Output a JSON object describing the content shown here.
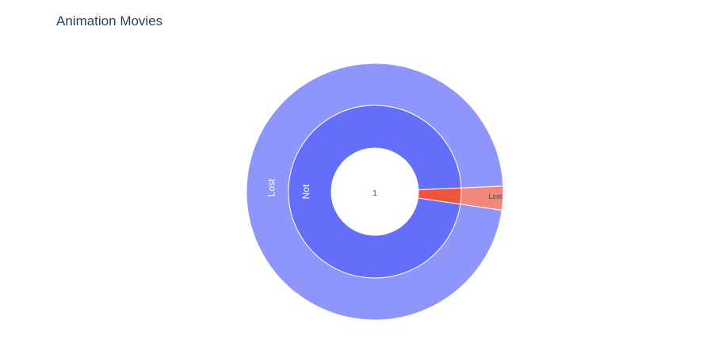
{
  "chart_data": {
    "type": "sunburst",
    "title": "Animation Movies",
    "center_label": "1",
    "inner_ring": [
      {
        "label": "Not",
        "value": 0.97,
        "color": "#636efa"
      },
      {
        "label": "",
        "value": 0.03,
        "color": "#ef553b"
      }
    ],
    "outer_ring": [
      {
        "label": "Lost",
        "value": 0.97,
        "color": "#8f96fb",
        "parent": "Not"
      },
      {
        "label": "Lost",
        "value": 0.03,
        "color": "#f4877b",
        "parent": ""
      }
    ]
  }
}
